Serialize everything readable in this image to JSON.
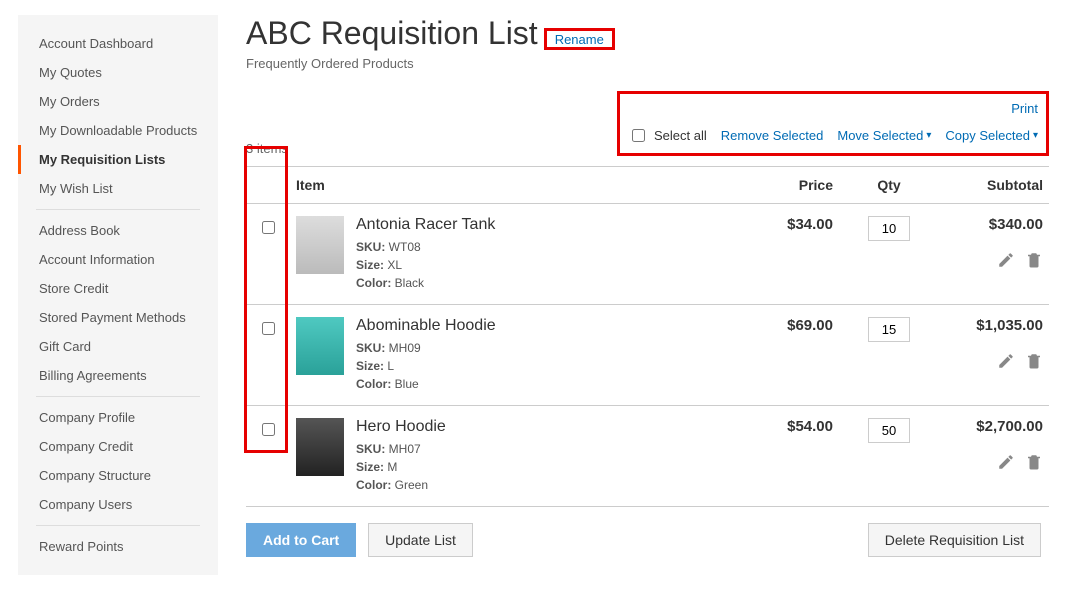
{
  "sidebar": {
    "groups": [
      [
        "Account Dashboard",
        "My Quotes",
        "My Orders",
        "My Downloadable Products",
        "My Requisition Lists",
        "My Wish List"
      ],
      [
        "Address Book",
        "Account Information",
        "Store Credit",
        "Stored Payment Methods",
        "Gift Card",
        "Billing Agreements"
      ],
      [
        "Company Profile",
        "Company Credit",
        "Company Structure",
        "Company Users"
      ],
      [
        "Reward Points"
      ]
    ],
    "active": "My Requisition Lists"
  },
  "title": "ABC Requisition List",
  "rename_label": "Rename",
  "subtitle": "Frequently Ordered Products",
  "item_count": "3 items",
  "print_label": "Print",
  "select_all_label": "Select all",
  "action_links": {
    "remove": "Remove Selected",
    "move": "Move Selected",
    "copy": "Copy Selected"
  },
  "columns": {
    "item": "Item",
    "price": "Price",
    "qty": "Qty",
    "subtotal": "Subtotal"
  },
  "items": [
    {
      "name": "Antonia Racer Tank",
      "sku": "WT08",
      "size": "XL",
      "color": "Black",
      "price": "$34.00",
      "qty": "10",
      "subtotal": "$340.00",
      "imgclass": ""
    },
    {
      "name": "Abominable Hoodie",
      "sku": "MH09",
      "size": "L",
      "color": "Blue",
      "price": "$69.00",
      "qty": "15",
      "subtotal": "$1,035.00",
      "imgclass": "teal"
    },
    {
      "name": "Hero Hoodie",
      "sku": "MH07",
      "size": "M",
      "color": "Green",
      "price": "$54.00",
      "qty": "50",
      "subtotal": "$2,700.00",
      "imgclass": "dark"
    }
  ],
  "labels": {
    "sku": "SKU:",
    "size": "Size:",
    "color": "Color:"
  },
  "buttons": {
    "add_to_cart": "Add to Cart",
    "update_list": "Update List",
    "delete_list": "Delete Requisition List"
  }
}
